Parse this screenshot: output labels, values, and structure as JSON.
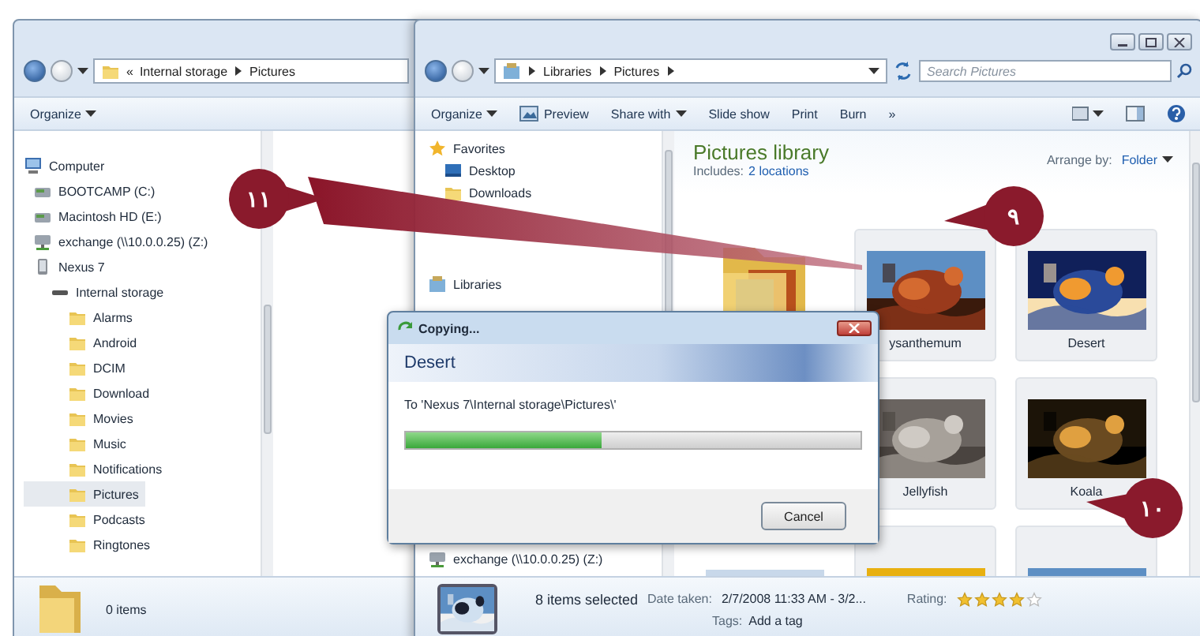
{
  "left_window": {
    "address": {
      "overflow": "«",
      "path": [
        "Internal storage",
        "Pictures"
      ]
    },
    "toolbar": [
      {
        "label": "Organize",
        "dropdown": true
      }
    ],
    "tree": [
      {
        "label": "Computer",
        "kind": "computer",
        "selected": false,
        "children": [
          {
            "label": "BOOTCAMP (C:)",
            "kind": "drive",
            "selected": false
          },
          {
            "label": "Macintosh HD (E:)",
            "kind": "drive",
            "selected": false
          },
          {
            "label": "exchange (\\\\10.0.0.25) (Z:)",
            "kind": "network",
            "selected": false
          },
          {
            "label": "Nexus 7",
            "kind": "device",
            "selected": false,
            "children": [
              {
                "label": "Internal storage",
                "kind": "storage",
                "selected": false,
                "children": [
                  {
                    "label": "Alarms",
                    "kind": "folder",
                    "selected": false
                  },
                  {
                    "label": "Android",
                    "kind": "folder",
                    "selected": false
                  },
                  {
                    "label": "DCIM",
                    "kind": "folder",
                    "selected": false
                  },
                  {
                    "label": "Download",
                    "kind": "folder",
                    "selected": false
                  },
                  {
                    "label": "Movies",
                    "kind": "folder",
                    "selected": false
                  },
                  {
                    "label": "Music",
                    "kind": "folder",
                    "selected": false
                  },
                  {
                    "label": "Notifications",
                    "kind": "folder",
                    "selected": false
                  },
                  {
                    "label": "Pictures",
                    "kind": "folder",
                    "selected": true
                  },
                  {
                    "label": "Podcasts",
                    "kind": "folder",
                    "selected": false
                  },
                  {
                    "label": "Ringtones",
                    "kind": "folder",
                    "selected": false
                  }
                ]
              }
            ]
          }
        ]
      }
    ],
    "status": "0 items"
  },
  "right_window": {
    "address": [
      "Libraries",
      "Pictures"
    ],
    "search": {
      "placeholder": "Search Pictures"
    },
    "toolbar": [
      {
        "label": "Organize",
        "kind": "menu"
      },
      {
        "label": "Preview",
        "kind": "preview"
      },
      {
        "label": "Share with",
        "kind": "menu"
      },
      {
        "label": "Slide show",
        "kind": "plain"
      },
      {
        "label": "Print",
        "kind": "plain"
      },
      {
        "label": "Burn",
        "kind": "plain"
      },
      {
        "label": "»",
        "kind": "plain"
      }
    ],
    "nav": [
      {
        "label": "Favorites",
        "kind": "star",
        "children": [
          {
            "label": "Desktop",
            "kind": "desktop"
          },
          {
            "label": "Downloads",
            "kind": "folder"
          }
        ]
      },
      {
        "label": "Libraries",
        "kind": "library"
      },
      {
        "label": "exchange (\\\\10.0.0.25) (Z:)",
        "kind": "network"
      }
    ],
    "library": {
      "title": "Pictures library",
      "includes_label": "Includes:",
      "includes_link": "2 locations",
      "arrange_label": "Arrange by:",
      "arrange_value": "Folder"
    },
    "tiles": [
      {
        "kind": "folder",
        "selected": false
      },
      {
        "kind": "picture",
        "label": "ysanthemum",
        "selected": true
      },
      {
        "kind": "picture",
        "label": "Desert",
        "selected": true
      },
      {
        "kind": "picture",
        "label": "Jellyfish",
        "selected": true
      },
      {
        "kind": "picture",
        "label": "Koala",
        "selected": true
      },
      {
        "kind": "picture",
        "selected": false
      },
      {
        "kind": "picture",
        "selected": true
      },
      {
        "kind": "picture",
        "selected": true
      }
    ],
    "details": {
      "count": "8 items selected",
      "date_label": "Date taken:",
      "date_value": "2/7/2008 11:33 AM - 3/2...",
      "rating_label": "Rating:",
      "stars": 4,
      "tags_label": "Tags:",
      "tags_value": "Add a tag"
    }
  },
  "dialog": {
    "title": "Copying...",
    "item": "Desert",
    "destination": "To 'Nexus 7\\Internal storage\\Pictures\\'",
    "level": 0.43,
    "button": "Cancel"
  },
  "callouts": [
    {
      "number": "١١"
    },
    {
      "number": "٩"
    },
    {
      "number": "١٠"
    }
  ]
}
